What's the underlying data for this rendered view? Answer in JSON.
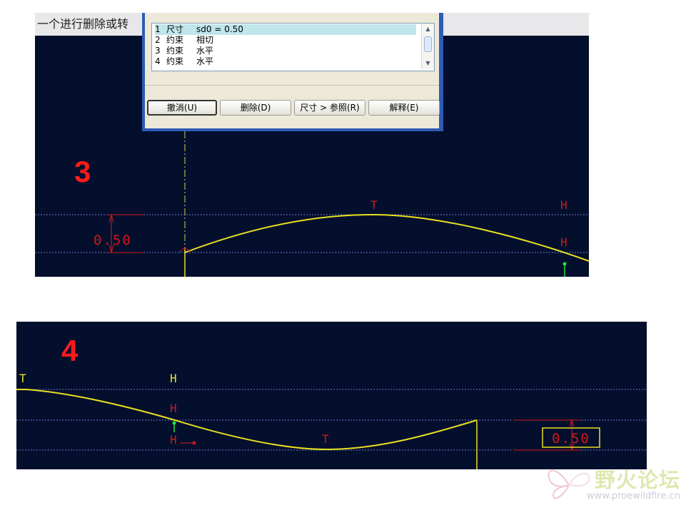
{
  "message_bar": {
    "text": "一个进行删除或转"
  },
  "dialog": {
    "items": [
      {
        "num": "1",
        "type": "尺寸",
        "value": "sd0 = 0.50"
      },
      {
        "num": "2",
        "type": "约束",
        "value": "相切"
      },
      {
        "num": "3",
        "type": "约束",
        "value": "水平"
      },
      {
        "num": "4",
        "type": "约束",
        "value": "水平"
      }
    ],
    "buttons": {
      "undo": "撤消(U)",
      "delete": "删除(D)",
      "dim_to_ref": "尺寸 > 参照(R)",
      "explain": "解释(E)"
    }
  },
  "step3": {
    "number": "3",
    "dim_value": "0.50",
    "labels": {
      "tangent": "T",
      "h1": "H",
      "h2": "H"
    }
  },
  "step4": {
    "number": "4",
    "dim_value": "0.50",
    "labels": {
      "tangent_left": "T",
      "h1": "H",
      "h2": "H",
      "h3": "H",
      "tangent_mid": "T"
    }
  },
  "watermark": {
    "cn": "野火论坛",
    "url": "www.proewildfire.cn"
  },
  "colors": {
    "canvas": "#040f2e",
    "curve": "#e8e020",
    "dimension": "#d01818",
    "gridline": "#6a79c0",
    "centerline": "#d8d040"
  }
}
